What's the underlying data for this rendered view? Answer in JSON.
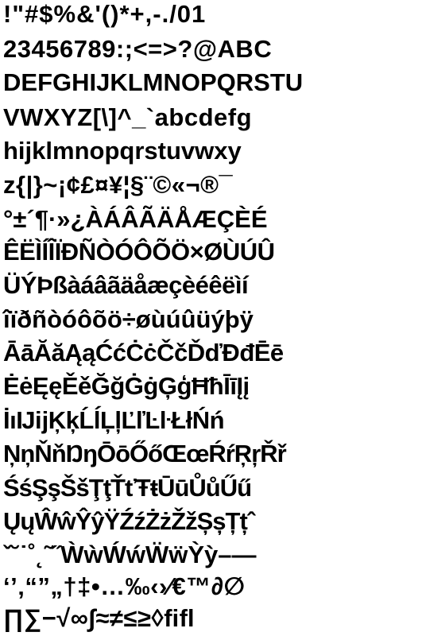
{
  "specimen": {
    "lines": [
      "!\"#$%&'()*+,-./01",
      "23456789:;<=>?@ABC",
      "DEFGHIJKLMNOPQRSTU",
      "VWXYZ[\\]^_`abcdefg",
      "hijklmnopqrstuvwxy",
      "z{|}~¡¢£¤¥¦§¨©«¬®¯",
      "°±´¶·»¿ÀÁÂÃÄÅÆÇÈÉ",
      "ÊËÌÍÎÏÐÑÒÓÔÕÖ×ØÙÚÛ",
      "ÜÝÞßàáâãäåæçèéêëìí",
      "îïðñòóôõö÷øùúûüýþÿ",
      "ĀāĂăĄąĆćĊċČčĎďĐđĒē",
      "ĖėĘęĚěĞğĠġĢģĦħĪīĮį",
      "İıĲĳĶķĹĺĻļĽľĿŀŁłŃń",
      "ŅņŇňŊŋŌōŐőŒœŔŕŖŗŘř",
      "ŚśŞşŠšŢţŤťŦŧŪūŮůŰű",
      "ŲųŴŵŶŷŸŹźŻżŽžȘșȚțˆ",
      "ˇ˘˙˚˛˜˝ẀẁẂẃẄẅỲỳ–—",
      "‘’‚“”„†‡•…‰‹›⁄€™∂∅",
      "∏∑−√∞∫≈≠≤≥◊ﬁﬂ"
    ]
  }
}
